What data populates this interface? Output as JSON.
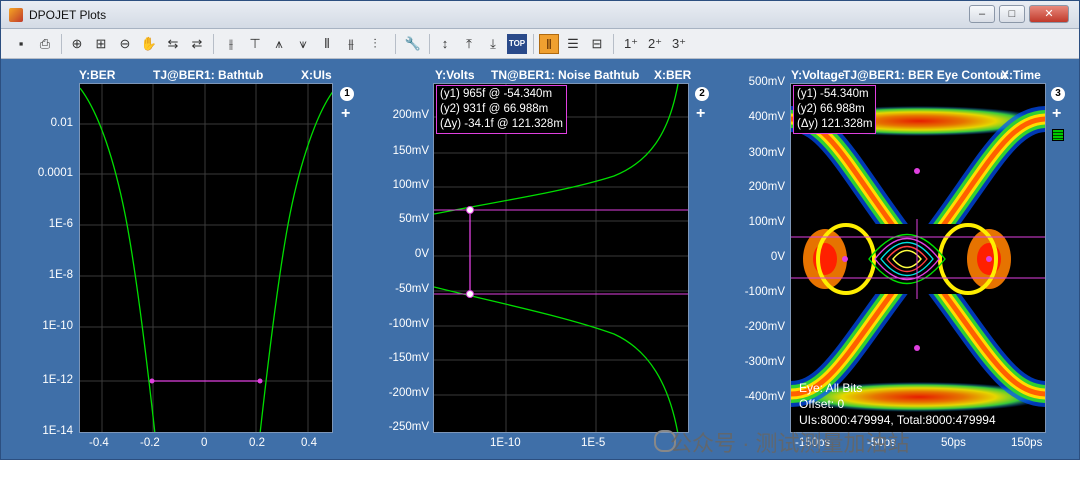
{
  "window": {
    "title": "DPOJET Plots",
    "controls": {
      "minimize": "–",
      "maximize": "□",
      "close": "✕"
    }
  },
  "toolbar": {
    "icons": [
      "save-icon",
      "print-icon",
      "zoom-in-icon",
      "zoom-area-icon",
      "zoom-out-icon",
      "pan-hand-icon",
      "pan-left-icon",
      "pan-right-icon",
      "cursor-v-icon",
      "cursor-h-icon",
      "cursor-peak-icon",
      "cursor-ref-icon",
      "cursor-lock-icon",
      "cursor-track-icon",
      "wrench-icon",
      "autoscale-icon",
      "align-top-icon",
      "align-bottom-icon",
      "top-icon",
      "layout-columns-icon",
      "layout-rows-icon",
      "layout-grid-icon",
      "plot-1-icon",
      "plot-2-icon",
      "plot-3-icon"
    ],
    "top_label": "TOP",
    "plot_labels": [
      "1",
      "2",
      "3"
    ]
  },
  "plots": [
    {
      "header_y": "Y:BER",
      "header_title": "TJ@BER1: Bathtub",
      "header_x": "X:UIs",
      "badge": "1",
      "plus": "+",
      "y_ticks": [
        "0.01",
        "0.0001",
        "1E-6",
        "1E-8",
        "1E-10",
        "1E-12",
        "1E-14"
      ],
      "x_ticks": [
        "-0.4",
        "-0.2",
        "0",
        "0.2",
        "0.4"
      ]
    },
    {
      "header_y": "Y:Volts",
      "header_title": "TN@BER1: Noise Bathtub",
      "header_x": "X:BER",
      "badge": "2",
      "plus": "+",
      "y_ticks": [
        "200mV",
        "150mV",
        "100mV",
        "50mV",
        "0V",
        "-50mV",
        "-100mV",
        "-150mV",
        "-200mV",
        "-250mV"
      ],
      "x_ticks": [
        "1E-10",
        "1E-5"
      ],
      "cursor": [
        "(y1) 965f @ -54.340m",
        "(y2) 931f @  66.988m",
        "(Δy) -34.1f @ 121.328m"
      ]
    },
    {
      "header_y": "Y:Voltage",
      "header_title": "TJ@BER1: BER Eye Contour",
      "header_x": "X:Time",
      "badge": "3",
      "plus": "+",
      "y_ticks": [
        "500mV",
        "400mV",
        "300mV",
        "200mV",
        "100mV",
        "0V",
        "-100mV",
        "-200mV",
        "-300mV",
        "-400mV"
      ],
      "x_ticks": [
        "-150ps",
        "-50ps",
        "50ps",
        "150ps"
      ],
      "cursor": [
        "(y1) -54.340m",
        "(y2)  66.988m",
        "(Δy) 121.328m"
      ],
      "info": [
        "Eye: All Bits",
        "Offset: 0",
        "UIs:8000:479994, Total:8000:479994"
      ]
    }
  ],
  "watermark": "公众号 · 测试测量加油站",
  "colors": {
    "window_bg": "#3f6fa8",
    "plot_bg": "#000000",
    "trace": "#00dd00",
    "cursor": "#e040e0"
  }
}
